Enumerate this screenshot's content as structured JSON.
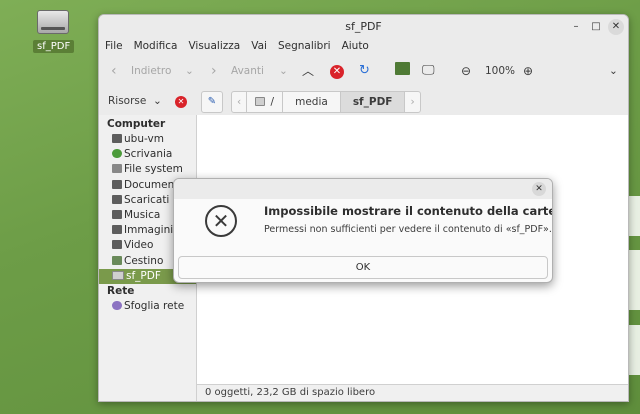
{
  "desktop": {
    "drive_label": "sf_PDF"
  },
  "window": {
    "title": "sf_PDF",
    "menu": [
      "File",
      "Modifica",
      "Visualizza",
      "Vai",
      "Segnalibri",
      "Aiuto"
    ],
    "toolbar": {
      "back": "Indietro",
      "forward": "Avanti",
      "zoom": "100%"
    },
    "sidebar_label": "Risorse",
    "path": [
      "/",
      "media",
      "sf_PDF"
    ],
    "sidebar": {
      "computer_header": "Computer",
      "items": [
        {
          "label": "ubu-vm",
          "icon": "folder-icon"
        },
        {
          "label": "Scrivania",
          "icon": "desktop-icon"
        },
        {
          "label": "File system",
          "icon": "filesystem-icon"
        },
        {
          "label": "Documenti",
          "icon": "folder-icon"
        },
        {
          "label": "Scaricati",
          "icon": "folder-icon"
        },
        {
          "label": "Musica",
          "icon": "folder-icon"
        },
        {
          "label": "Immagini",
          "icon": "folder-icon"
        },
        {
          "label": "Video",
          "icon": "folder-icon"
        },
        {
          "label": "Cestino",
          "icon": "trash-icon"
        },
        {
          "label": "sf_PDF",
          "icon": "drive-icon",
          "selected": true
        }
      ],
      "network_header": "Rete",
      "network_items": [
        {
          "label": "Sfoglia rete",
          "icon": "network-icon"
        }
      ]
    },
    "status": "0 oggetti, 23,2 GB di spazio libero"
  },
  "dialog": {
    "title": "Impossibile mostrare il contenuto della cartella.",
    "message": "Permessi non sufficienti per vedere il contenuto di «sf_PDF».",
    "ok_label": "OK"
  },
  "colors": {
    "accent": "#7a9a4b",
    "stop": "#d9232a",
    "desktop": "#6d9d47"
  }
}
